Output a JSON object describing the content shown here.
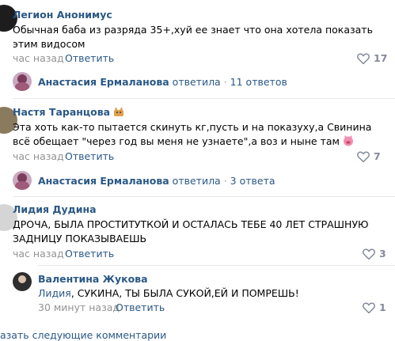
{
  "comments": [
    {
      "author": "Легион Анонимус",
      "text": "Обычная баба из разряда 35+,хуй ее знает что она хотела показать этим видосом",
      "time": "час назад",
      "reply": "Ответить",
      "likes": "17",
      "thread": {
        "name": "Анастасия Ермаланова",
        "verb": "ответила",
        "sep": "·",
        "count": "11 ответов"
      }
    },
    {
      "author": "Настя Таранцова",
      "text": "Эта хоть как-то пытается скинуть кг,пусть и на показуху,а Свинина всё обещает \"через год вы меня не узнаете\",а воз и ныне там",
      "time": "час назад",
      "reply": "Ответить",
      "likes": "7",
      "thread": {
        "name": "Анастасия Ермаланова",
        "verb": "ответила",
        "sep": "·",
        "count": "3 ответа"
      }
    },
    {
      "author": "Лидия Дудина",
      "text": "ДРОЧА, БЫЛА ПРОСТИТУТКОЙ И ОСТАЛАСЬ ТЕБЕ 40 ЛЕТ СТРАШНУЮ ЗАДНИЦУ ПОКАЗЫВАЕШЬ",
      "time": "час назад",
      "reply": "Ответить",
      "likes": "3"
    },
    {
      "author": "Валентина Жукова",
      "mention": "Лидия",
      "text": ", СУКИНА, ТЫ БЫЛА СУКОЙ,ЕЙ И ПОМРЕШЬ!",
      "time": "30 минут назад",
      "reply": "Ответить",
      "likes": "1"
    }
  ],
  "footer": "азать следующие комментарии",
  "colors": {
    "link": "#2a5885",
    "meta": "#939393",
    "like": "#828a99",
    "divider": "#e7e8ec"
  },
  "icons": [
    "heart-icon",
    "cat-emoji-icon",
    "pig-emoji-icon"
  ]
}
